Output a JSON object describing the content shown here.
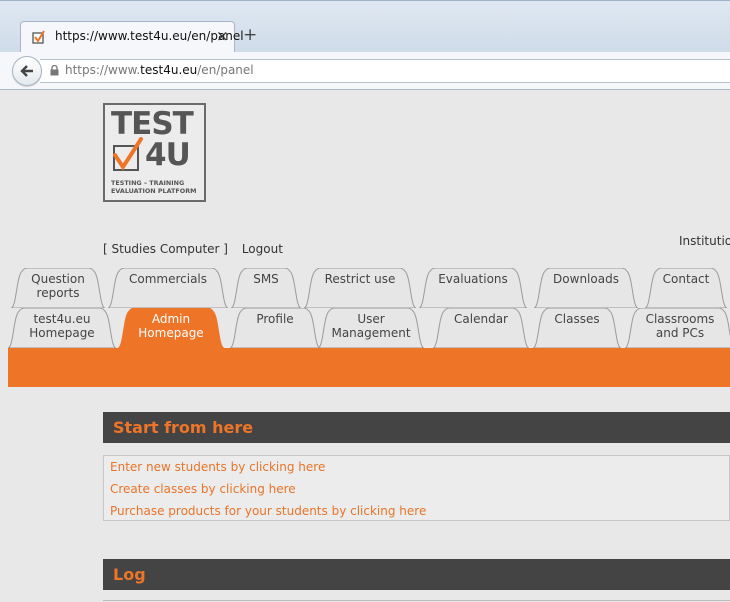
{
  "browser": {
    "tab_title": "https://www.test4u.eu/en/panel",
    "tab_close": "×",
    "new_tab": "+",
    "url_prefix": "https://www.",
    "url_domain": "test4u.eu",
    "url_path": "/en/panel"
  },
  "logo": {
    "line1": "TEST",
    "line2": "4U",
    "line3": "TESTING  –  TRAINING",
    "line4": "EVALUATION PLATFORM"
  },
  "header": {
    "user_label": "[ Studies Computer ]",
    "logout": "Logout",
    "institution": "Institutio"
  },
  "tabs_row1": [
    {
      "label": "Question\nreports"
    },
    {
      "label": "Commercials"
    },
    {
      "label": "SMS"
    },
    {
      "label": "Restrict use"
    },
    {
      "label": "Evaluations"
    },
    {
      "label": "Downloads"
    },
    {
      "label": "Contact"
    }
  ],
  "tabs_row2": [
    {
      "label": "test4u.eu\nHomepage"
    },
    {
      "label": "Admin\nHomepage"
    },
    {
      "label": "Profile"
    },
    {
      "label": "User\nManagement"
    },
    {
      "label": "Calendar"
    },
    {
      "label": "Classes"
    },
    {
      "label": "Classrooms\nand PCs"
    }
  ],
  "sections": {
    "start_title": "Start from here",
    "links": [
      "Enter new students by clicking here",
      "Create classes by clicking here",
      "Purchase products for your students by clicking here"
    ],
    "log_title": "Log"
  },
  "colors": {
    "accent": "#ee7528",
    "section_bg": "#444444",
    "tab_bg": "#e6e6e6"
  }
}
